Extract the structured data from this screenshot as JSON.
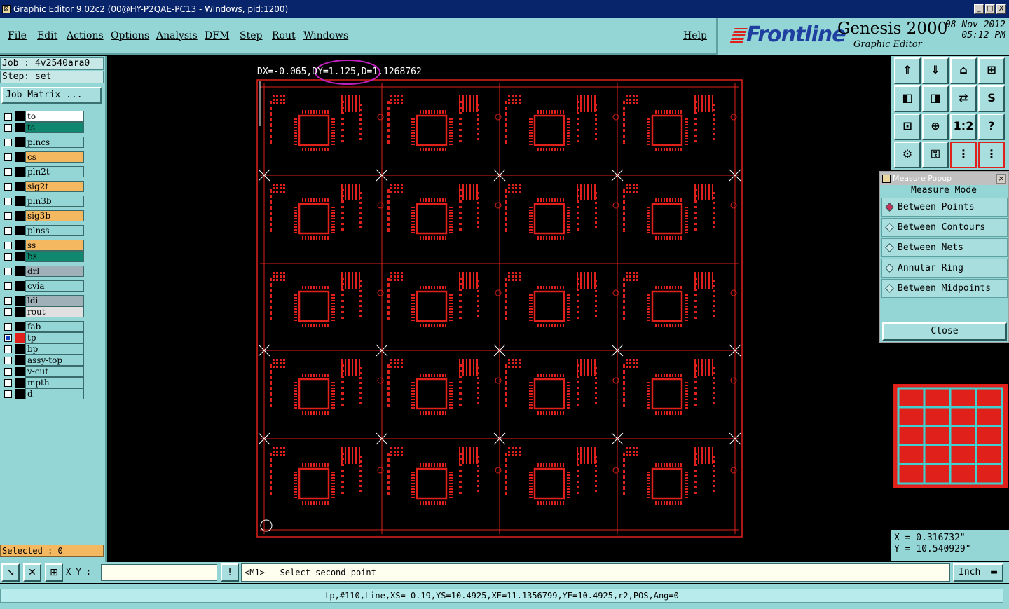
{
  "window": {
    "title": "Graphic Editor 9.02c2 (00@HY-P2QAE-PC13 - Windows, pid:1200)",
    "minimize": "_",
    "maximize": "□",
    "close": "X"
  },
  "menu": {
    "items": [
      "File",
      "Edit",
      "Actions",
      "Options",
      "Analysis",
      "DFM",
      "Step",
      "Rout",
      "Windows"
    ],
    "help": "Help"
  },
  "branding": {
    "logo": "Frontline",
    "product": "Genesis 2000",
    "subtitle": "Graphic Editor",
    "date": "08 Nov 2012",
    "time": "05:12 PM"
  },
  "job": {
    "job_label": "Job : 4v2540ara0",
    "step_label": "Step: set",
    "matrix_button": "Job Matrix ..."
  },
  "layers": [
    {
      "name": "to",
      "color": "#ffffff"
    },
    {
      "name": "ts",
      "color": "#108870"
    },
    {
      "name": "plncs",
      "color": "#94d6d6"
    },
    {
      "name": "cs",
      "color": "#f4b860"
    },
    {
      "name": "pln2t",
      "color": "#94d6d6"
    },
    {
      "name": "sig2t",
      "color": "#f4b860"
    },
    {
      "name": "pln3b",
      "color": "#94d6d6"
    },
    {
      "name": "sig3b",
      "color": "#f4b860"
    },
    {
      "name": "plnss",
      "color": "#94d6d6"
    },
    {
      "name": "ss",
      "color": "#f4b860"
    },
    {
      "name": "bs",
      "color": "#108870"
    },
    {
      "name": "drl",
      "color": "#a0b0b8"
    },
    {
      "name": "cvia",
      "color": "#94d6d6"
    },
    {
      "name": "ldi",
      "color": "#a0b0b8"
    },
    {
      "name": "rout",
      "color": "#e0e0e0"
    },
    {
      "name": "fab",
      "color": "#94d6d6"
    },
    {
      "name": "tp",
      "color": "#94d6d6",
      "active": true
    },
    {
      "name": "bp",
      "color": "#94d6d6"
    },
    {
      "name": "assy-top",
      "color": "#94d6d6"
    },
    {
      "name": "v-cut",
      "color": "#94d6d6"
    },
    {
      "name": "mpth",
      "color": "#94d6d6"
    },
    {
      "name": "d",
      "color": "#94d6d6"
    }
  ],
  "selected": "Selected : 0",
  "measure_readout": "DX=-0.065,DY=1.125,D=1.1268762",
  "popup": {
    "title": "Measure Popup",
    "heading": "Measure Mode",
    "options": [
      "Between Points",
      "Between Contours",
      "Between Nets",
      "Annular Ring",
      "Between Midpoints"
    ],
    "selected_option": "Between Points",
    "close": "Close"
  },
  "coords": {
    "x": "X = 0.316732\"",
    "y": "Y = 10.540929\""
  },
  "cmd": {
    "xy_label": "X Y :",
    "xy_value": "",
    "prompt": "<M1> - Select second point",
    "unit": "Inch"
  },
  "status": "tp,#110,Line,XS=-0.19,YS=10.4925,XE=11.1356799,YE=10.4925,r2,POS,Ang=0",
  "colors": {
    "panel": "#94d6d6",
    "trace": "#e0201a",
    "highlight": "#c020c0"
  }
}
